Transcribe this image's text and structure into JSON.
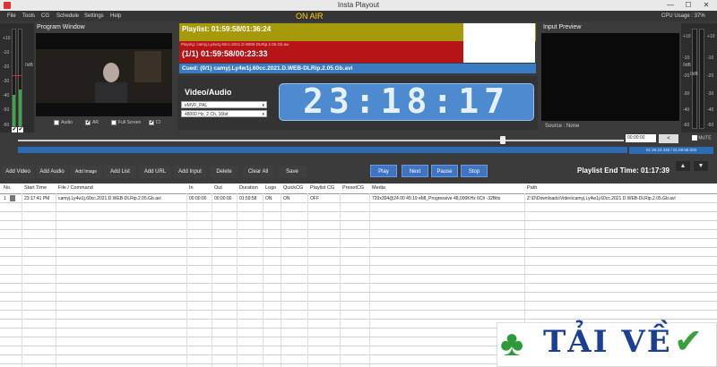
{
  "window": {
    "title": "Insta Playout",
    "minimize": "—",
    "maximize": "☐",
    "close": "✕"
  },
  "menu": [
    "File",
    "Tools",
    "CG",
    "Schedule",
    "Settings",
    "Help"
  ],
  "status": {
    "on_air": "ON AIR",
    "cpu": "CPU Usage : 37%"
  },
  "vu_left": {
    "labels": [
      "+10",
      "-10",
      "-20",
      "-30",
      "-40",
      "-50",
      "-60"
    ],
    "db": "0dB",
    "level_a": 0.32,
    "level_b": 0.38
  },
  "vu_right_a": {
    "labels": [
      "+10",
      "-10",
      "-20",
      "-30",
      "-40",
      "-60"
    ],
    "db": "0dB"
  },
  "vu_right_b": {
    "labels": [
      "+10",
      "-10",
      "-20",
      "-30",
      "-40",
      "-60"
    ],
    "db": "0dB"
  },
  "program": {
    "title": "Program Window",
    "checks": [
      {
        "label": "Audio",
        "checked": false
      },
      {
        "label": "AR",
        "checked": true
      },
      {
        "label": "Full Screen",
        "checked": false
      },
      {
        "label": "CI",
        "checked": true
      }
    ]
  },
  "playlist": {
    "header": "Playlist: 01:59:58/01:36:24",
    "playing": "Playing: camyj.Ly4w1j.60cc.2021.D.WEB-DLRip.2.05.Gb.avi",
    "current": "(1/1) 01:59:58/00:23:33",
    "cued": "Cued: (0/1) camyj.Ly4w1j.60cc.2021.D.WEB-DLRip.2.05.Gb.avi"
  },
  "videoaudio": {
    "title": "Video/Audio",
    "video_format": "eMVF_PAL",
    "audio_format": "48000 Hz, 2 Ch, 16bit"
  },
  "clock": "23:18:17",
  "input": {
    "title": "Input Preview",
    "source": "Source : None"
  },
  "seek": {
    "time": "00:00:00",
    "button": "<",
    "mute": "MUTE",
    "position": 0.8,
    "progress_text": "01:36:23.338 / 01:59:58.000"
  },
  "toolbar": [
    "Add Video",
    "Add Audio",
    "Add Image",
    "Add List",
    "Add URL",
    "Add Input",
    "Delete",
    "Clear All",
    "Save"
  ],
  "transport": [
    "Play",
    "Next",
    "Pause",
    "Stop"
  ],
  "end_time": "Playlist End Time: 01:17:39",
  "arrows": [
    "▲",
    "▼"
  ],
  "table": {
    "headers": [
      "No.",
      "Start Time",
      "File / Command",
      "In",
      "Out",
      "Duration",
      "Logo",
      "QuickCG",
      "Playlist CG",
      "PresetCG",
      "Media",
      "Path"
    ],
    "rows": [
      [
        "1",
        "23:17:41 PM",
        "camyj.Ly4w1j.60cc.2021.D.WEB-DLRip.2.05.Gb.avi",
        "00:00:00",
        "00:00:00",
        "01:59:58",
        "ON",
        "ON",
        "OFF",
        "",
        "720x304@24.00 45:19 eMI_Progressive 48,000KHz 6Ch -32Bits",
        "Z:\\D\\Downloads\\Video\\camyj.Ly4w1j.60cc.2021.D.WEB-DLRip.2.05.Gb.avi"
      ]
    ]
  },
  "badge": {
    "text": "TẢI VỀ",
    "leaf": "♣",
    "check": "✔",
    "colors": {
      "text": "#1b3f95",
      "leaf": "#2e9b3a",
      "check": "#38a13c"
    }
  }
}
